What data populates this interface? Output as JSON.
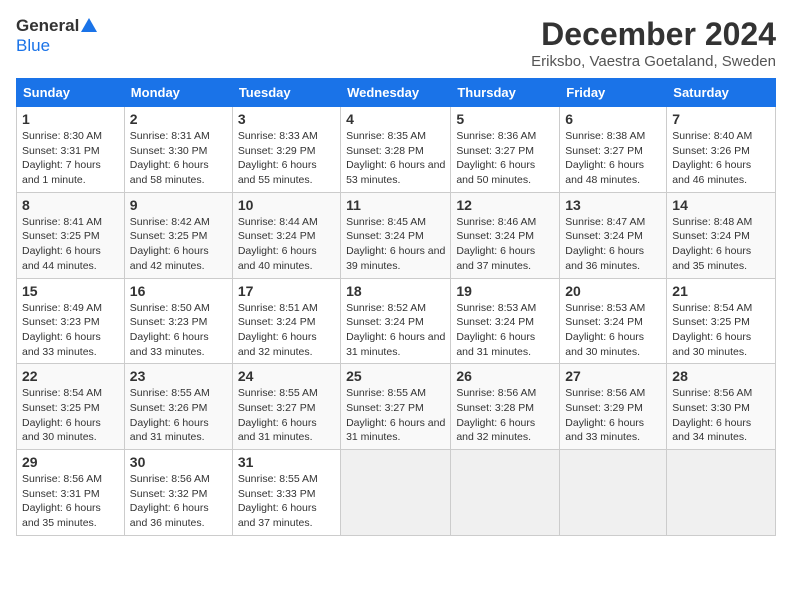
{
  "header": {
    "logo_general": "General",
    "logo_blue": "Blue",
    "title": "December 2024",
    "subtitle": "Eriksbo, Vaestra Goetaland, Sweden"
  },
  "days_of_week": [
    "Sunday",
    "Monday",
    "Tuesday",
    "Wednesday",
    "Thursday",
    "Friday",
    "Saturday"
  ],
  "weeks": [
    [
      {
        "date": "1",
        "sunrise": "Sunrise: 8:30 AM",
        "sunset": "Sunset: 3:31 PM",
        "daylight": "Daylight: 7 hours and 1 minute."
      },
      {
        "date": "2",
        "sunrise": "Sunrise: 8:31 AM",
        "sunset": "Sunset: 3:30 PM",
        "daylight": "Daylight: 6 hours and 58 minutes."
      },
      {
        "date": "3",
        "sunrise": "Sunrise: 8:33 AM",
        "sunset": "Sunset: 3:29 PM",
        "daylight": "Daylight: 6 hours and 55 minutes."
      },
      {
        "date": "4",
        "sunrise": "Sunrise: 8:35 AM",
        "sunset": "Sunset: 3:28 PM",
        "daylight": "Daylight: 6 hours and 53 minutes."
      },
      {
        "date": "5",
        "sunrise": "Sunrise: 8:36 AM",
        "sunset": "Sunset: 3:27 PM",
        "daylight": "Daylight: 6 hours and 50 minutes."
      },
      {
        "date": "6",
        "sunrise": "Sunrise: 8:38 AM",
        "sunset": "Sunset: 3:27 PM",
        "daylight": "Daylight: 6 hours and 48 minutes."
      },
      {
        "date": "7",
        "sunrise": "Sunrise: 8:40 AM",
        "sunset": "Sunset: 3:26 PM",
        "daylight": "Daylight: 6 hours and 46 minutes."
      }
    ],
    [
      {
        "date": "8",
        "sunrise": "Sunrise: 8:41 AM",
        "sunset": "Sunset: 3:25 PM",
        "daylight": "Daylight: 6 hours and 44 minutes."
      },
      {
        "date": "9",
        "sunrise": "Sunrise: 8:42 AM",
        "sunset": "Sunset: 3:25 PM",
        "daylight": "Daylight: 6 hours and 42 minutes."
      },
      {
        "date": "10",
        "sunrise": "Sunrise: 8:44 AM",
        "sunset": "Sunset: 3:24 PM",
        "daylight": "Daylight: 6 hours and 40 minutes."
      },
      {
        "date": "11",
        "sunrise": "Sunrise: 8:45 AM",
        "sunset": "Sunset: 3:24 PM",
        "daylight": "Daylight: 6 hours and 39 minutes."
      },
      {
        "date": "12",
        "sunrise": "Sunrise: 8:46 AM",
        "sunset": "Sunset: 3:24 PM",
        "daylight": "Daylight: 6 hours and 37 minutes."
      },
      {
        "date": "13",
        "sunrise": "Sunrise: 8:47 AM",
        "sunset": "Sunset: 3:24 PM",
        "daylight": "Daylight: 6 hours and 36 minutes."
      },
      {
        "date": "14",
        "sunrise": "Sunrise: 8:48 AM",
        "sunset": "Sunset: 3:24 PM",
        "daylight": "Daylight: 6 hours and 35 minutes."
      }
    ],
    [
      {
        "date": "15",
        "sunrise": "Sunrise: 8:49 AM",
        "sunset": "Sunset: 3:23 PM",
        "daylight": "Daylight: 6 hours and 33 minutes."
      },
      {
        "date": "16",
        "sunrise": "Sunrise: 8:50 AM",
        "sunset": "Sunset: 3:23 PM",
        "daylight": "Daylight: 6 hours and 33 minutes."
      },
      {
        "date": "17",
        "sunrise": "Sunrise: 8:51 AM",
        "sunset": "Sunset: 3:24 PM",
        "daylight": "Daylight: 6 hours and 32 minutes."
      },
      {
        "date": "18",
        "sunrise": "Sunrise: 8:52 AM",
        "sunset": "Sunset: 3:24 PM",
        "daylight": "Daylight: 6 hours and 31 minutes."
      },
      {
        "date": "19",
        "sunrise": "Sunrise: 8:53 AM",
        "sunset": "Sunset: 3:24 PM",
        "daylight": "Daylight: 6 hours and 31 minutes."
      },
      {
        "date": "20",
        "sunrise": "Sunrise: 8:53 AM",
        "sunset": "Sunset: 3:24 PM",
        "daylight": "Daylight: 6 hours and 30 minutes."
      },
      {
        "date": "21",
        "sunrise": "Sunrise: 8:54 AM",
        "sunset": "Sunset: 3:25 PM",
        "daylight": "Daylight: 6 hours and 30 minutes."
      }
    ],
    [
      {
        "date": "22",
        "sunrise": "Sunrise: 8:54 AM",
        "sunset": "Sunset: 3:25 PM",
        "daylight": "Daylight: 6 hours and 30 minutes."
      },
      {
        "date": "23",
        "sunrise": "Sunrise: 8:55 AM",
        "sunset": "Sunset: 3:26 PM",
        "daylight": "Daylight: 6 hours and 31 minutes."
      },
      {
        "date": "24",
        "sunrise": "Sunrise: 8:55 AM",
        "sunset": "Sunset: 3:27 PM",
        "daylight": "Daylight: 6 hours and 31 minutes."
      },
      {
        "date": "25",
        "sunrise": "Sunrise: 8:55 AM",
        "sunset": "Sunset: 3:27 PM",
        "daylight": "Daylight: 6 hours and 31 minutes."
      },
      {
        "date": "26",
        "sunrise": "Sunrise: 8:56 AM",
        "sunset": "Sunset: 3:28 PM",
        "daylight": "Daylight: 6 hours and 32 minutes."
      },
      {
        "date": "27",
        "sunrise": "Sunrise: 8:56 AM",
        "sunset": "Sunset: 3:29 PM",
        "daylight": "Daylight: 6 hours and 33 minutes."
      },
      {
        "date": "28",
        "sunrise": "Sunrise: 8:56 AM",
        "sunset": "Sunset: 3:30 PM",
        "daylight": "Daylight: 6 hours and 34 minutes."
      }
    ],
    [
      {
        "date": "29",
        "sunrise": "Sunrise: 8:56 AM",
        "sunset": "Sunset: 3:31 PM",
        "daylight": "Daylight: 6 hours and 35 minutes."
      },
      {
        "date": "30",
        "sunrise": "Sunrise: 8:56 AM",
        "sunset": "Sunset: 3:32 PM",
        "daylight": "Daylight: 6 hours and 36 minutes."
      },
      {
        "date": "31",
        "sunrise": "Sunrise: 8:55 AM",
        "sunset": "Sunset: 3:33 PM",
        "daylight": "Daylight: 6 hours and 37 minutes."
      },
      null,
      null,
      null,
      null
    ]
  ]
}
